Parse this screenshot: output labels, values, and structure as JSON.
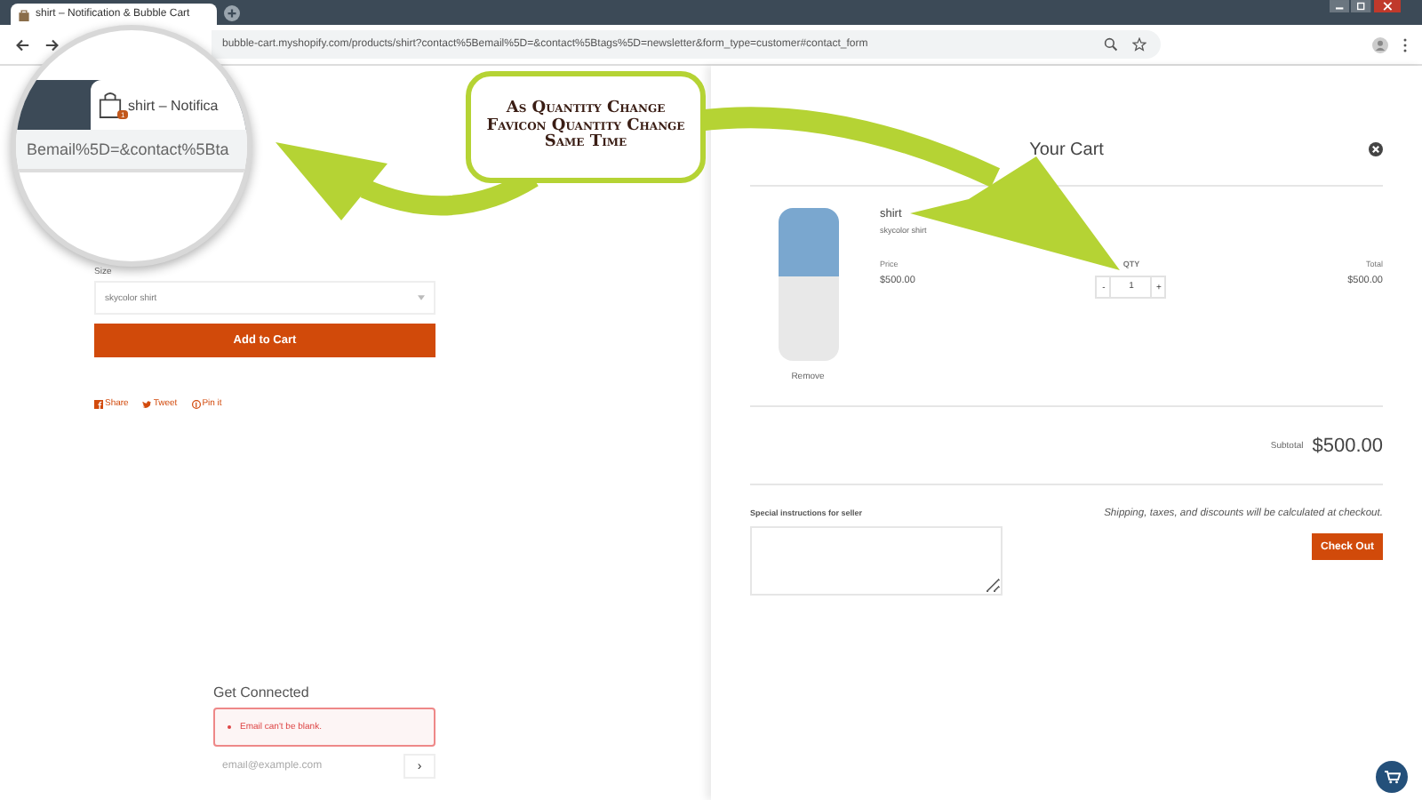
{
  "browser": {
    "tab_title": "shirt – Notification & Bubble Cart",
    "url": "bubble-cart.myshopify.com/products/shirt?contact%5Bemail%5D=&contact%5Btags%5D=newsletter&form_type=customer#contact_form",
    "magnifier": {
      "tab_title": "shirt – Notifica",
      "badge": "1",
      "url_fragment": "Bemail%5D=&contact%5Bta"
    }
  },
  "annotation": {
    "lines": [
      "As Quantity Change",
      "Favicon Quantity Change",
      "Same Time"
    ]
  },
  "product": {
    "option_label": "Size",
    "option_value": "skycolor shirt",
    "add_button": "Add to Cart",
    "share_links": [
      {
        "kind": "facebook",
        "label": "Share"
      },
      {
        "kind": "twitter",
        "label": "Tweet"
      },
      {
        "kind": "pinterest",
        "label": "Pin it"
      }
    ]
  },
  "newsletter": {
    "title": "Get Connected",
    "error": "Email can't be blank.",
    "placeholder": "email@example.com",
    "submit": "›"
  },
  "cart": {
    "title": "Your Cart",
    "item": {
      "name": "shirt",
      "variant": "skycolor shirt",
      "remove": "Remove",
      "price_label": "Price",
      "price": "$500.00",
      "qty_label": "QTY",
      "minus": "-",
      "qty": "1",
      "plus": "+",
      "total_label": "Total",
      "total": "$500.00"
    },
    "subtotal_label": "Subtotal",
    "subtotal": "$500.00",
    "instructions_label": "Special instructions for seller",
    "note": "Shipping, taxes, and discounts will be calculated at checkout.",
    "checkout": "Check Out"
  }
}
